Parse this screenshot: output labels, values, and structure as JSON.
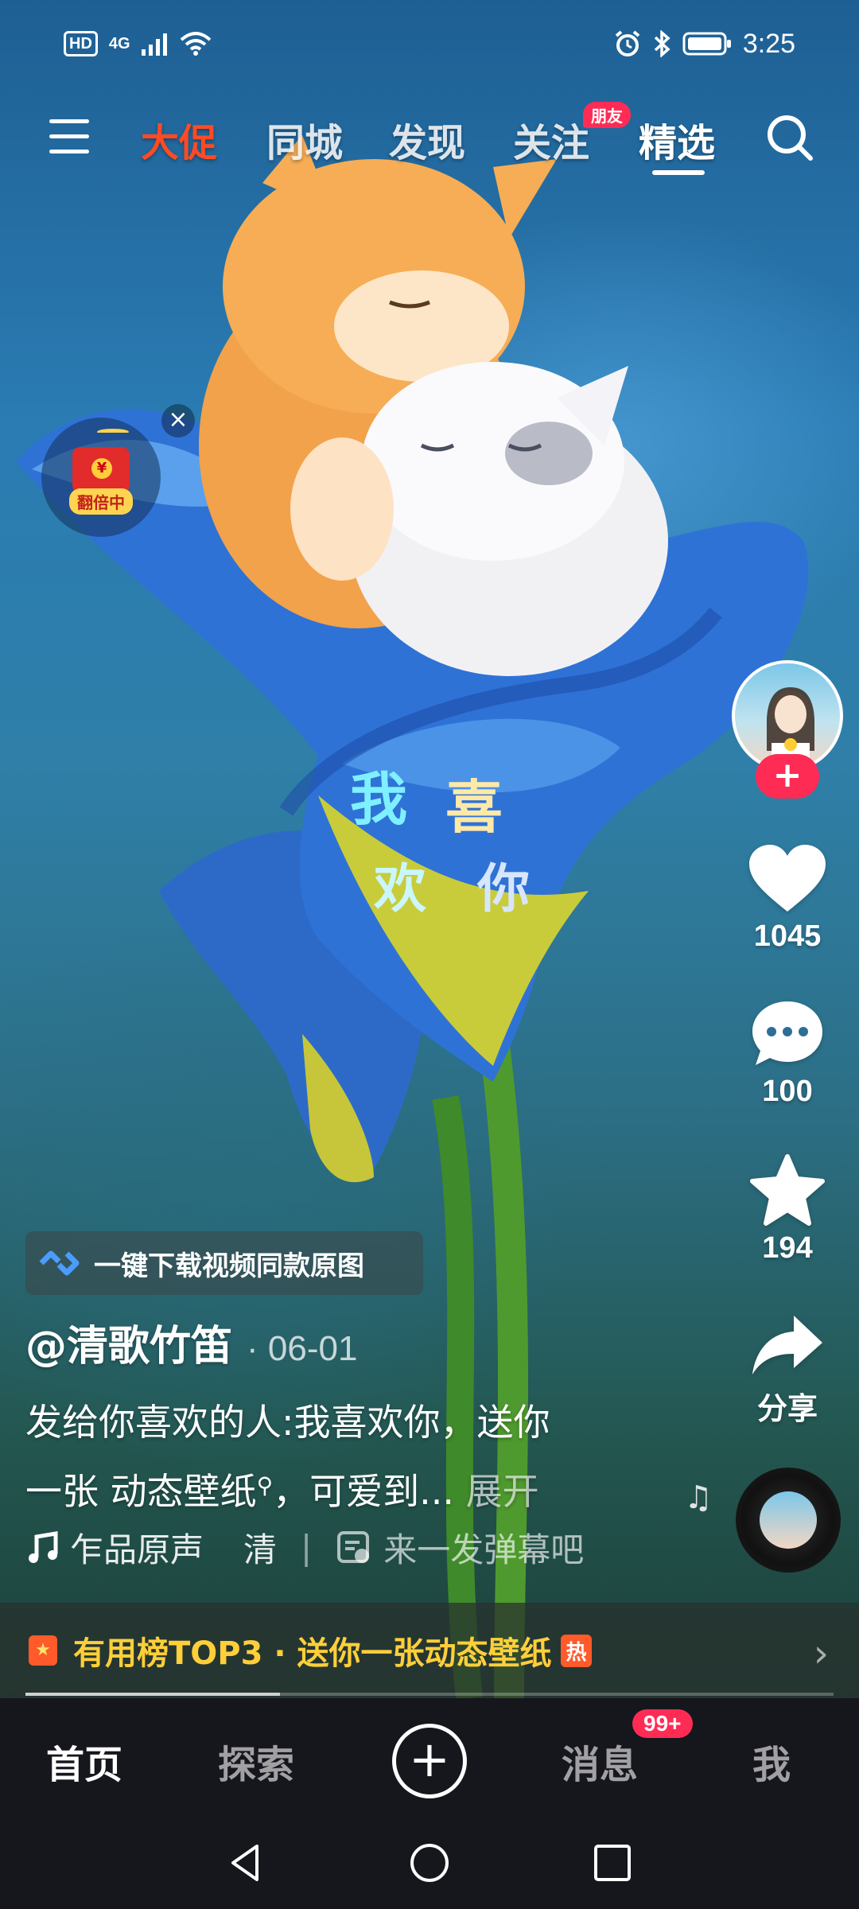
{
  "status_bar": {
    "hd": "HD",
    "network": "4G",
    "time": "3:25",
    "icons": [
      "signal-icon",
      "wifi-icon",
      "alarm-icon",
      "bluetooth-icon",
      "battery-icon"
    ]
  },
  "top_nav": {
    "tabs": [
      {
        "label": "大促"
      },
      {
        "label": "同城"
      },
      {
        "label": "发现"
      },
      {
        "label": "关注"
      },
      {
        "label": "精选"
      }
    ],
    "friend_badge": "朋友",
    "active_tab": "精选"
  },
  "red_packet": {
    "label": "翻倍中"
  },
  "video": {
    "overlay_text": [
      "我",
      "喜",
      "欢",
      "你"
    ]
  },
  "actions": {
    "likes": "1045",
    "comments": "100",
    "favorites": "194",
    "share_label": "分享"
  },
  "info": {
    "download_chip": "一键下载视频同款原图",
    "author": "@清歌竹笛",
    "date": "· 06-01",
    "description_line1": "发给你喜欢的人:我喜欢你，送你",
    "description_line2_a": "一张 动态壁纸",
    "description_line2_b": "，可爱到...",
    "expand": "展开",
    "music": "乍品原声",
    "music_tail": "清",
    "danmu_prompt": "来一发弹幕吧"
  },
  "hot_banner": {
    "text": "有用榜TOP3 · 送你一张动态壁纸",
    "badge": "热"
  },
  "progress": 0.315,
  "tab_bar": {
    "tabs": [
      {
        "label": "首页"
      },
      {
        "label": "探索"
      },
      {
        "label": "消息"
      },
      {
        "label": "我"
      }
    ],
    "message_badge": "99+"
  },
  "colors": {
    "accent_red": "#fe2c55",
    "promo_orange": "#ff4a24",
    "hot_yellow": "#ffcf3a"
  }
}
